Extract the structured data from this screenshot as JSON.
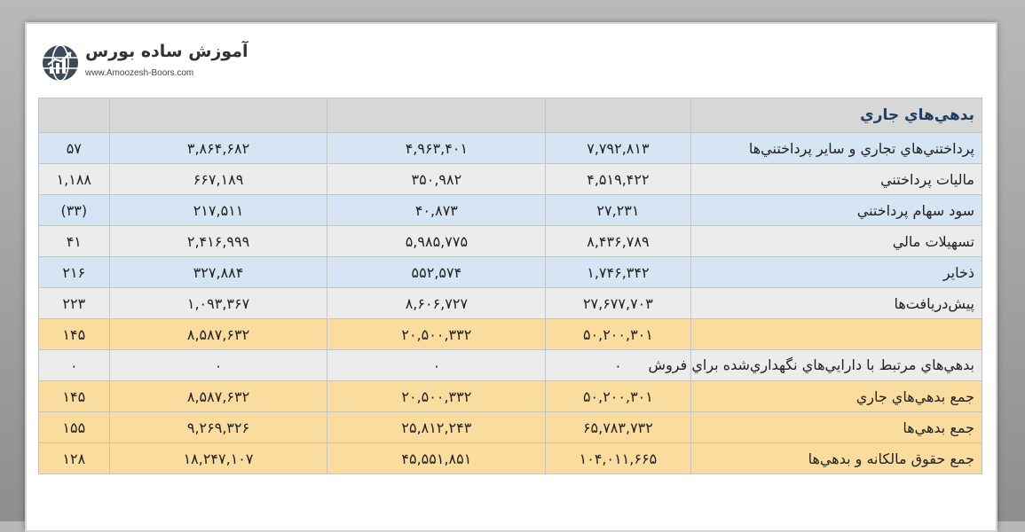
{
  "logo": {
    "name": "آموزش ساده بورس",
    "url": "www.Amoozesh-Boors.com"
  },
  "table": {
    "header": "بدهي‌هاي جاري",
    "rows": [
      {
        "label": "پرداختني‌هاي تجاري و ساير پرداختني‌ها",
        "c1": "۷,۷۹۲,۸۱۳",
        "c2": "۴,۹۶۳,۴۰۱",
        "c3": "۳,۸۶۴,۶۸۲",
        "c4": "۵۷",
        "style": "blue"
      },
      {
        "label": "ماليات پرداختني",
        "c1": "۴,۵۱۹,۴۲۲",
        "c2": "۳۵۰,۹۸۲",
        "c3": "۶۶۷,۱۸۹",
        "c4": "۱,۱۸۸",
        "style": "gray"
      },
      {
        "label": "سود سهام پرداختني",
        "c1": "۲۷,۲۳۱",
        "c2": "۴۰,۸۷۳",
        "c3": "۲۱۷,۵۱۱",
        "c4": "(۳۳)",
        "style": "blue",
        "neg": true
      },
      {
        "label": "تسهيلات مالي",
        "c1": "۸,۴۳۶,۷۸۹",
        "c2": "۵,۹۸۵,۷۷۵",
        "c3": "۲,۴۱۶,۹۹۹",
        "c4": "۴۱",
        "style": "gray"
      },
      {
        "label": "ذخاير",
        "c1": "۱,۷۴۶,۳۴۲",
        "c2": "۵۵۲,۵۷۴",
        "c3": "۳۲۷,۸۸۴",
        "c4": "۲۱۶",
        "style": "blue"
      },
      {
        "label": "پيش‌دريافت‌ها",
        "c1": "۲۷,۶۷۷,۷۰۳",
        "c2": "۸,۶۰۶,۷۲۷",
        "c3": "۱,۰۹۳,۳۶۷",
        "c4": "۲۲۳",
        "style": "gray"
      },
      {
        "label": "",
        "c1": "۵۰,۲۰۰,۳۰۱",
        "c2": "۲۰,۵۰۰,۳۳۲",
        "c3": "۸,۵۸۷,۶۳۲",
        "c4": "۱۴۵",
        "style": "gold"
      },
      {
        "label": "بدهي‌هاي مرتبط با دارايي‌هاي نگهداري‌شده براي فروش",
        "c1": "۰",
        "c2": "۰",
        "c3": "۰",
        "c4": "۰",
        "style": "gray",
        "wrap": true
      },
      {
        "label": "جمع بدهي‌هاي جاري",
        "c1": "۵۰,۲۰۰,۳۰۱",
        "c2": "۲۰,۵۰۰,۳۳۲",
        "c3": "۸,۵۸۷,۶۳۲",
        "c4": "۱۴۵",
        "style": "gold"
      },
      {
        "label": "جمع بدهي‌ها",
        "c1": "۶۵,۷۸۳,۷۳۲",
        "c2": "۲۵,۸۱۲,۲۴۳",
        "c3": "۹,۲۶۹,۳۲۶",
        "c4": "۱۵۵",
        "style": "gold"
      },
      {
        "label": "جمع حقوق مالکانه و بدهي‌ها",
        "c1": "۱۰۴,۰۱۱,۶۶۵",
        "c2": "۴۵,۵۵۱,۸۵۱",
        "c3": "۱۸,۲۴۷,۱۰۷",
        "c4": "۱۲۸",
        "style": "gold"
      }
    ]
  }
}
